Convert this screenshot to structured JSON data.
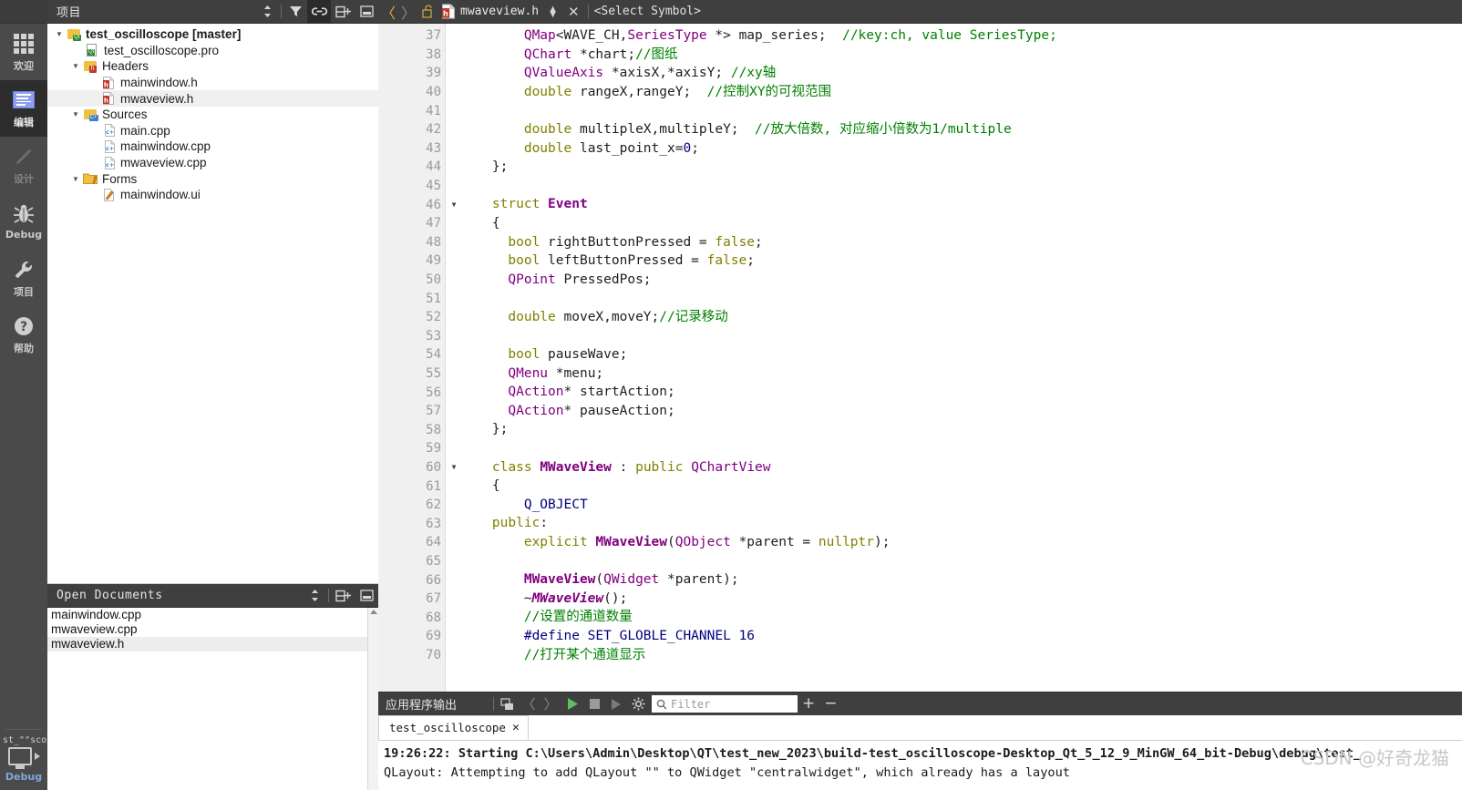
{
  "modebar": {
    "items": [
      {
        "label": "欢迎",
        "icon": "grid-icon",
        "state": "normal"
      },
      {
        "label": "编辑",
        "icon": "document-lines-icon",
        "state": "active"
      },
      {
        "label": "设计",
        "icon": "pencil-icon",
        "state": "disabled"
      },
      {
        "label": "Debug",
        "icon": "bug-icon",
        "state": "normal"
      },
      {
        "label": "项目",
        "icon": "wrench-icon",
        "state": "normal"
      },
      {
        "label": "帮助",
        "icon": "question-mark-icon",
        "state": "normal"
      }
    ],
    "kit_name": "st_\"\"scope",
    "run_label": "Debug"
  },
  "project_panel": {
    "title": "项目",
    "icons": [
      "sync-arrows-icon",
      "filter-icon",
      "link-icon",
      "split-add-icon",
      "collapse-icon"
    ],
    "tree": [
      {
        "label": "test_oscilloscope [master]",
        "indent": 0,
        "icon": "qt-project-folder-icon",
        "arrow": "down",
        "bold": true,
        "selected": false
      },
      {
        "label": "test_oscilloscope.pro",
        "indent": 1,
        "icon": "qt-pro-file-icon",
        "arrow": "",
        "bold": false,
        "selected": false
      },
      {
        "label": "Headers",
        "indent": 1,
        "icon": "headers-folder-icon",
        "arrow": "down",
        "bold": false,
        "selected": false
      },
      {
        "label": "mainwindow.h",
        "indent": 2,
        "icon": "h-file-icon",
        "arrow": "",
        "bold": false,
        "selected": false
      },
      {
        "label": "mwaveview.h",
        "indent": 2,
        "icon": "h-file-icon",
        "arrow": "",
        "bold": false,
        "selected": true
      },
      {
        "label": "Sources",
        "indent": 1,
        "icon": "sources-folder-icon",
        "arrow": "down",
        "bold": false,
        "selected": false
      },
      {
        "label": "main.cpp",
        "indent": 2,
        "icon": "cpp-file-icon",
        "arrow": "",
        "bold": false,
        "selected": false
      },
      {
        "label": "mainwindow.cpp",
        "indent": 2,
        "icon": "cpp-file-icon",
        "arrow": "",
        "bold": false,
        "selected": false
      },
      {
        "label": "mwaveview.cpp",
        "indent": 2,
        "icon": "cpp-file-icon",
        "arrow": "",
        "bold": false,
        "selected": false
      },
      {
        "label": "Forms",
        "indent": 1,
        "icon": "forms-folder-icon",
        "arrow": "down",
        "bold": false,
        "selected": false
      },
      {
        "label": "mainwindow.ui",
        "indent": 2,
        "icon": "ui-file-icon",
        "arrow": "",
        "bold": false,
        "selected": false
      }
    ]
  },
  "open_documents": {
    "title": "Open Documents",
    "icons": [
      "sync-arrows-icon",
      "split-add-icon",
      "collapse-icon"
    ],
    "items": [
      {
        "label": "mainwindow.cpp",
        "selected": false
      },
      {
        "label": "mwaveview.cpp",
        "selected": false
      },
      {
        "label": "mwaveview.h",
        "selected": true
      }
    ]
  },
  "editor_tabbar": {
    "back_icon": "chevron-left-icon",
    "forward_icon": "chevron-right-icon",
    "lock_icon": "unlocked-padlock-icon",
    "file_icon": "h-file-icon",
    "filename": "mwaveview.h",
    "dropdown_icon": "updown-arrows-icon",
    "close_icon": "close-icon",
    "symbol_selector": "<Select Symbol>"
  },
  "editor": {
    "first_line": 37,
    "fold_lines": [
      46,
      60
    ],
    "lines": [
      {
        "n": 37,
        "tokens": [
          {
            "t": "        ",
            "c": "plain"
          },
          {
            "t": "QMap",
            "c": "type"
          },
          {
            "t": "<",
            "c": "plain"
          },
          {
            "t": "WAVE_CH",
            "c": "plain"
          },
          {
            "t": ",",
            "c": "plain"
          },
          {
            "t": "SeriesType",
            "c": "type"
          },
          {
            "t": " *> ",
            "c": "plain"
          },
          {
            "t": "map_series",
            "c": "plain"
          },
          {
            "t": ";  ",
            "c": "plain"
          },
          {
            "t": "//key:ch, value SeriesType;",
            "c": "cmt"
          }
        ]
      },
      {
        "n": 38,
        "tokens": [
          {
            "t": "        ",
            "c": "plain"
          },
          {
            "t": "QChart",
            "c": "type"
          },
          {
            "t": " *chart;",
            "c": "plain"
          },
          {
            "t": "//图纸",
            "c": "cmt"
          }
        ]
      },
      {
        "n": 39,
        "tokens": [
          {
            "t": "        ",
            "c": "plain"
          },
          {
            "t": "QValueAxis",
            "c": "type"
          },
          {
            "t": " *axisX,*axisY; ",
            "c": "plain"
          },
          {
            "t": "//xy轴",
            "c": "cmt"
          }
        ]
      },
      {
        "n": 40,
        "tokens": [
          {
            "t": "        ",
            "c": "plain"
          },
          {
            "t": "double",
            "c": "kw"
          },
          {
            "t": " rangeX,rangeY;  ",
            "c": "plain"
          },
          {
            "t": "//控制XY的可视范围",
            "c": "cmt"
          }
        ]
      },
      {
        "n": 41,
        "tokens": []
      },
      {
        "n": 42,
        "tokens": [
          {
            "t": "        ",
            "c": "plain"
          },
          {
            "t": "double",
            "c": "kw"
          },
          {
            "t": " multipleX,multipleY;  ",
            "c": "plain"
          },
          {
            "t": "//放大倍数, 对应缩小倍数为1/multiple",
            "c": "cmt"
          }
        ]
      },
      {
        "n": 43,
        "tokens": [
          {
            "t": "        ",
            "c": "plain"
          },
          {
            "t": "double",
            "c": "kw"
          },
          {
            "t": " last_point_x=",
            "c": "plain"
          },
          {
            "t": "0",
            "c": "num"
          },
          {
            "t": ";",
            "c": "plain"
          }
        ]
      },
      {
        "n": 44,
        "tokens": [
          {
            "t": "    };",
            "c": "plain"
          }
        ]
      },
      {
        "n": 45,
        "tokens": []
      },
      {
        "n": 46,
        "tokens": [
          {
            "t": "    ",
            "c": "plain"
          },
          {
            "t": "struct",
            "c": "kw"
          },
          {
            "t": " ",
            "c": "plain"
          },
          {
            "t": "Event",
            "c": "cls"
          }
        ]
      },
      {
        "n": 47,
        "tokens": [
          {
            "t": "    {",
            "c": "plain"
          }
        ]
      },
      {
        "n": 48,
        "tokens": [
          {
            "t": "      ",
            "c": "plain"
          },
          {
            "t": "bool",
            "c": "kw"
          },
          {
            "t": " rightButtonPressed = ",
            "c": "plain"
          },
          {
            "t": "false",
            "c": "kw"
          },
          {
            "t": ";",
            "c": "plain"
          }
        ]
      },
      {
        "n": 49,
        "tokens": [
          {
            "t": "      ",
            "c": "plain"
          },
          {
            "t": "bool",
            "c": "kw"
          },
          {
            "t": " leftButtonPressed = ",
            "c": "plain"
          },
          {
            "t": "false",
            "c": "kw"
          },
          {
            "t": ";",
            "c": "plain"
          }
        ]
      },
      {
        "n": 50,
        "tokens": [
          {
            "t": "      ",
            "c": "plain"
          },
          {
            "t": "QPoint",
            "c": "type"
          },
          {
            "t": " PressedPos;",
            "c": "plain"
          }
        ]
      },
      {
        "n": 51,
        "tokens": []
      },
      {
        "n": 52,
        "tokens": [
          {
            "t": "      ",
            "c": "plain"
          },
          {
            "t": "double",
            "c": "kw"
          },
          {
            "t": " moveX,moveY;",
            "c": "plain"
          },
          {
            "t": "//记录移动",
            "c": "cmt"
          }
        ]
      },
      {
        "n": 53,
        "tokens": []
      },
      {
        "n": 54,
        "tokens": [
          {
            "t": "      ",
            "c": "plain"
          },
          {
            "t": "bool",
            "c": "kw"
          },
          {
            "t": " pauseWave;",
            "c": "plain"
          }
        ]
      },
      {
        "n": 55,
        "tokens": [
          {
            "t": "      ",
            "c": "plain"
          },
          {
            "t": "QMenu",
            "c": "type"
          },
          {
            "t": " *menu;",
            "c": "plain"
          }
        ]
      },
      {
        "n": 56,
        "tokens": [
          {
            "t": "      ",
            "c": "plain"
          },
          {
            "t": "QAction",
            "c": "type"
          },
          {
            "t": "* startAction;",
            "c": "plain"
          }
        ]
      },
      {
        "n": 57,
        "tokens": [
          {
            "t": "      ",
            "c": "plain"
          },
          {
            "t": "QAction",
            "c": "type"
          },
          {
            "t": "* pauseAction;",
            "c": "plain"
          }
        ]
      },
      {
        "n": 58,
        "tokens": [
          {
            "t": "    };",
            "c": "plain"
          }
        ]
      },
      {
        "n": 59,
        "tokens": []
      },
      {
        "n": 60,
        "tokens": [
          {
            "t": "    ",
            "c": "plain"
          },
          {
            "t": "class",
            "c": "kw"
          },
          {
            "t": " ",
            "c": "plain"
          },
          {
            "t": "MWaveView",
            "c": "cls"
          },
          {
            "t": " : ",
            "c": "plain"
          },
          {
            "t": "public",
            "c": "kw"
          },
          {
            "t": " ",
            "c": "plain"
          },
          {
            "t": "QChartView",
            "c": "type"
          }
        ]
      },
      {
        "n": 61,
        "tokens": [
          {
            "t": "    {",
            "c": "plain"
          }
        ]
      },
      {
        "n": 62,
        "tokens": [
          {
            "t": "        ",
            "c": "plain"
          },
          {
            "t": "Q_OBJECT",
            "c": "macro"
          }
        ]
      },
      {
        "n": 63,
        "tokens": [
          {
            "t": "    ",
            "c": "plain"
          },
          {
            "t": "public",
            "c": "kw"
          },
          {
            "t": ":",
            "c": "plain"
          }
        ]
      },
      {
        "n": 64,
        "tokens": [
          {
            "t": "        ",
            "c": "plain"
          },
          {
            "t": "explicit",
            "c": "kw"
          },
          {
            "t": " ",
            "c": "plain"
          },
          {
            "t": "MWaveView",
            "c": "cls"
          },
          {
            "t": "(",
            "c": "plain"
          },
          {
            "t": "QObject",
            "c": "type"
          },
          {
            "t": " *parent = ",
            "c": "plain"
          },
          {
            "t": "nullptr",
            "c": "kw"
          },
          {
            "t": ");",
            "c": "plain"
          }
        ]
      },
      {
        "n": 65,
        "tokens": []
      },
      {
        "n": 66,
        "tokens": [
          {
            "t": "        ",
            "c": "plain"
          },
          {
            "t": "MWaveView",
            "c": "cls"
          },
          {
            "t": "(",
            "c": "plain"
          },
          {
            "t": "QWidget",
            "c": "type"
          },
          {
            "t": " *parent);",
            "c": "plain"
          }
        ]
      },
      {
        "n": 67,
        "tokens": [
          {
            "t": "        ~",
            "c": "plain"
          },
          {
            "t": "MWaveView",
            "c": "dtor"
          },
          {
            "t": "();",
            "c": "plain"
          }
        ]
      },
      {
        "n": 68,
        "tokens": [
          {
            "t": "        ",
            "c": "plain"
          },
          {
            "t": "//设置的通道数量",
            "c": "cmt"
          }
        ]
      },
      {
        "n": 69,
        "tokens": [
          {
            "t": "        ",
            "c": "plain"
          },
          {
            "t": "#define",
            "c": "pre"
          },
          {
            "t": " SET_GLOBLE_CHANNEL ",
            "c": "pre"
          },
          {
            "t": "16",
            "c": "pre"
          }
        ]
      },
      {
        "n": 70,
        "tokens": [
          {
            "t": "        ",
            "c": "plain"
          },
          {
            "t": "//打开某个通道显示",
            "c": "cmt"
          }
        ]
      }
    ]
  },
  "output_panel": {
    "title": "应用程序输出",
    "buttons": [
      "wrap-lines-icon",
      "prev-item-icon",
      "next-item-icon",
      "run-icon",
      "stop-icon",
      "step-icon",
      "settings-gear-icon"
    ],
    "filter_placeholder": "Filter",
    "search_icon": "search-icon",
    "zoom_in_label": "+",
    "zoom_out_label": "−",
    "tab_label": "test_oscilloscope",
    "tab_close_icon": "close-icon",
    "lines": [
      "19:26:22: Starting C:\\Users\\Admin\\Desktop\\QT\\test_new_2023\\build-test_oscilloscope-Desktop_Qt_5_12_9_MinGW_64_bit-Debug\\debug\\test_",
      "QLayout: Attempting to add QLayout \"\" to QWidget \"centralwidget\", which already has a layout"
    ],
    "watermark": "CSDN @好奇龙猫"
  },
  "colors": {
    "chrome_dark": "#3f3f3f",
    "modebar": "#4a4a4a",
    "active_mode": "#2d2d2d",
    "selection": "#f0f0f0",
    "keyword": "#808000",
    "type": "#800080",
    "comment": "#008000",
    "preproc": "#000080"
  }
}
